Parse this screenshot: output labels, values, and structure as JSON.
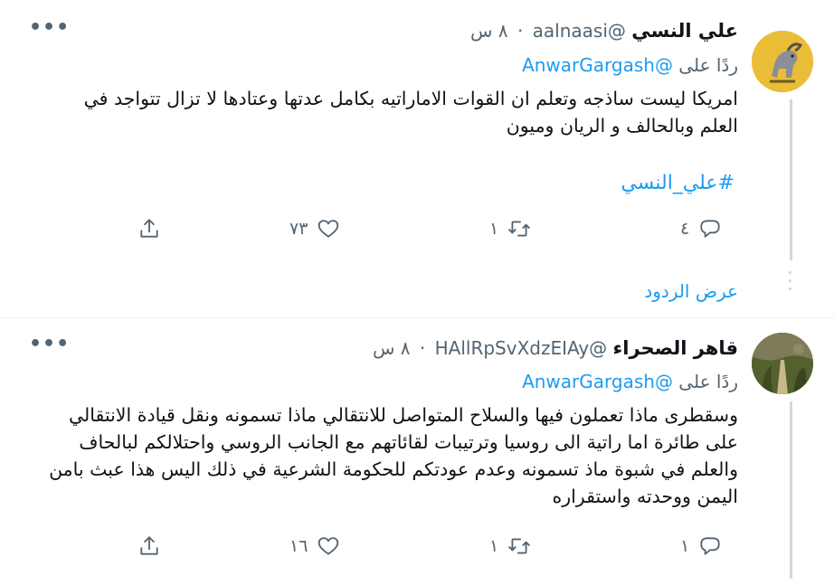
{
  "tweets": [
    {
      "name": "علي النسي",
      "handle": "@aalnaasi",
      "separator": "·",
      "time": "٨ س",
      "more_label": "•••",
      "replying_prefix": "ردًا على",
      "replying_to": "@AnwarGargash",
      "text": "امريكا ليست ساذجه وتعلم ان القوات الاماراتيه بكامل عدتها وعتادها لا تزال تتواجد في العلم وبالحالف و الريان وميون",
      "hashtag": "#علي_النسي",
      "reply_count": "٤",
      "retweet_count": "١",
      "like_count": "٧٣",
      "show_replies": "عرض الردود"
    },
    {
      "name": "قاهر الصحراء",
      "handle": "@HAllRpSvXdzEIAy",
      "separator": "·",
      "time": "٨ س",
      "more_label": "•••",
      "replying_prefix": "ردًا على",
      "replying_to": "@AnwarGargash",
      "text": "وسقطرى ماذا تعملون فيها والسلاح المتواصل للانتقالي ماذا تسمونه ونقل قيادة الانتقالي على طائرة اما راتية الى روسيا وترتيبات لقائاتهم مع الجانب الروسي  واحتلالكم لبالحاف والعلم في شبوة ماذ تسمونه وعدم عودتكم للحكومة الشرعية في ذلك اليس هذا عبث بامن اليمن ووحدته واستقراره",
      "reply_count": "١",
      "retweet_count": "١",
      "like_count": "١٦"
    }
  ],
  "icons": {
    "reply": "reply-icon",
    "retweet": "retweet-icon",
    "like": "heart-icon",
    "share": "share-icon"
  },
  "colors": {
    "accent": "#1d9bf0",
    "secondary_text": "#536471",
    "thread_line": "#cfd9de"
  }
}
